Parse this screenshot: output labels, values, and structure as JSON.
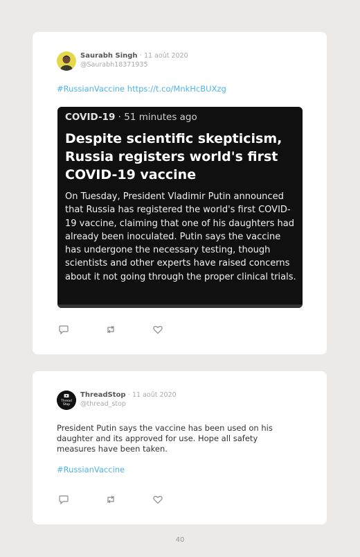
{
  "tweet1": {
    "author_name": "Saurabh Singh",
    "separator": "·",
    "date": "11 août 2020",
    "handle": "@Saurabh18371935",
    "hashtag": "#RussianVaccine",
    "url": "https://t.co/MnkHcBUXzg",
    "embed": {
      "topic": "COVID-19",
      "topic_separator": "·",
      "time_ago": "51 minutes ago",
      "headline": "Despite scientific skepticism, Russia registers world's first COVID-19 vaccine",
      "body": "On Tuesday, President Vladimir Putin announced that Russia has registered the world's first COVID-19 vaccine, claiming that one of his daughters had already been inoculated. Putin says the vaccine has undergone the necessary testing, though scientists and other experts have raised concerns about it not going through the proper clinical trials."
    },
    "actions": [
      "reply-icon",
      "retweet-icon",
      "like-icon"
    ]
  },
  "tweet2": {
    "author_name": "ThreadStop",
    "avatar_text_line1": "Thread",
    "avatar_text_line2": "Stop",
    "separator": "·",
    "date": "11 août 2020",
    "handle": "@thread_stop",
    "text": "President Putin says the vaccine has been used on his daughter and its approved for use. Hope all safety measures have been taken.",
    "hashtag": "#RussianVaccine",
    "actions": [
      "reply-icon",
      "retweet-icon",
      "like-icon"
    ]
  },
  "page_number": "40",
  "colors": {
    "background": "#ebeae8",
    "card": "#ffffff",
    "link": "#4fb3e8",
    "embed_bg": "#101010"
  }
}
